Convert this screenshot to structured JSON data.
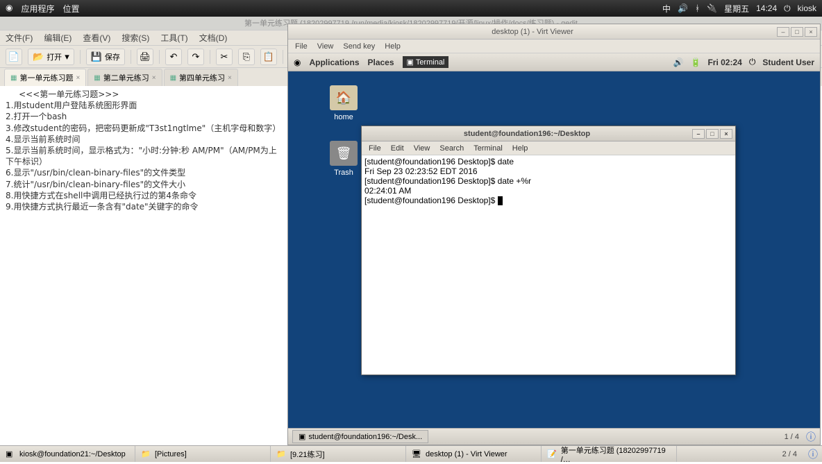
{
  "outer_panel": {
    "apps": "应用程序",
    "places": "位置",
    "ime": "中",
    "day": "星期五",
    "time": "14:24",
    "user": "kiosk"
  },
  "gedit": {
    "title_path": "第一单元练习题  (18202997719 /run/media/kiosk/18202997719/开源/linux/操作/docs/练习题) - gedit",
    "menus": [
      "文件(F)",
      "编辑(E)",
      "查看(V)",
      "搜索(S)",
      "工具(T)",
      "文档(D)"
    ],
    "toolbar": {
      "open": "打开",
      "save": "保存"
    },
    "tabs": [
      {
        "label": "第一单元练习题",
        "active": true
      },
      {
        "label": "第二单元练习",
        "active": false
      },
      {
        "label": "第四单元练习",
        "active": false
      }
    ],
    "content": "     <<<第一单元练习题>>>\n1.用student用户登陆系统图形界面\n2.打开一个bash\n3.修改student的密码，把密码更新成\"T3st1ngtlme\"（主机字母和数字）\n4.显示当前系统时间\n5.显示当前系统时间，显示格式为：\"小时:分钟:秒 AM/PM\"（AM/PM为上下午标识）\n6.显示\"/usr/bin/clean-binary-files\"的文件类型\n7.统计\"/usr/bin/clean-binary-files\"的文件大小\n8.用快捷方式在shell中调用已经执行过的第4条命令\n9.用快捷方式执行最近一条含有\"date\"关键字的命令"
  },
  "virt": {
    "title": "desktop (1) - Virt Viewer",
    "menus": [
      "File",
      "View",
      "Send key",
      "Help"
    ],
    "inner_panel": {
      "apps": "Applications",
      "places": "Places",
      "terminal": "Terminal",
      "time": "Fri 02:24",
      "user": "Student User"
    },
    "desktop_icons": {
      "home": "home",
      "trash": "Trash"
    },
    "terminal": {
      "title": "student@foundation196:~/Desktop",
      "menus": [
        "File",
        "Edit",
        "View",
        "Search",
        "Terminal",
        "Help"
      ],
      "lines": [
        "[student@foundation196 Desktop]$ date",
        "Fri Sep 23 02:23:52 EDT 2016",
        "[student@foundation196 Desktop]$ date +%r",
        "02:24:01 AM",
        "[student@foundation196 Desktop]$ "
      ]
    },
    "inner_task": "student@foundation196:~/Desk...",
    "inner_ws": "1 / 4"
  },
  "outer_taskbar": {
    "items": [
      "kiosk@foundation21:~/Desktop",
      "[Pictures]",
      "[9.21练习]",
      "desktop (1) - Virt Viewer",
      "第一单元练习题  (18202997719 /…"
    ],
    "ws": "2 / 4"
  }
}
